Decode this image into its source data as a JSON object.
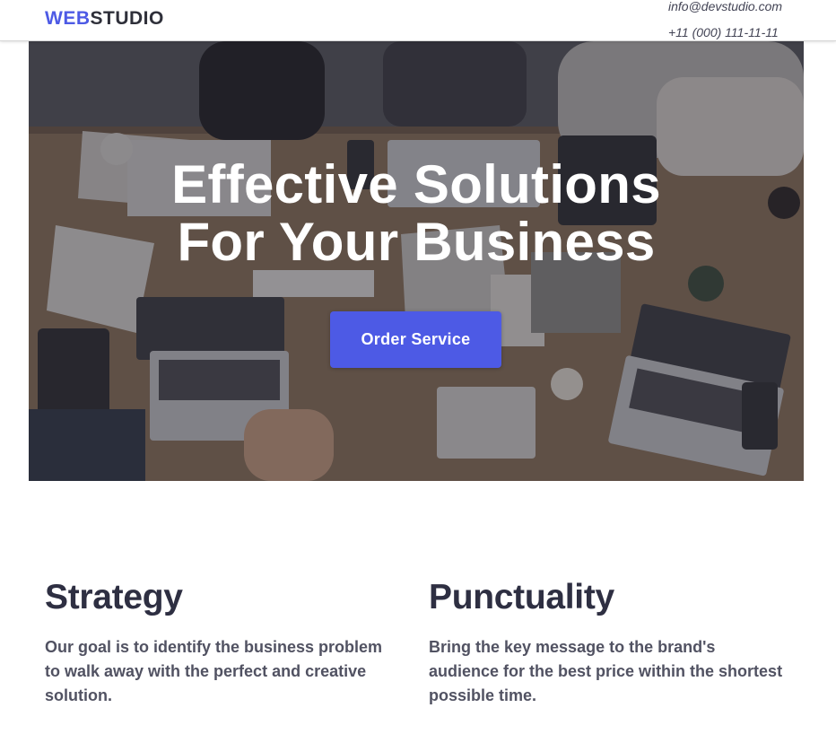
{
  "header": {
    "logo_accent": "WEB",
    "logo_rest": "STUDIO",
    "email": "info@devstudio.com",
    "phone": "+11 (000) 111-11-11"
  },
  "hero": {
    "title": "Effective Solutions\nFor Your Business",
    "button_label": "Order Service",
    "image": "office-desk-meeting-photo"
  },
  "features": [
    {
      "title": "Strategy",
      "text": "Our goal is to identify the business problem to walk away with the perfect and creative solution."
    },
    {
      "title": "Punctuality",
      "text": "Bring the key message to the brand's audience for the best price within the shortest possible time."
    }
  ],
  "colors": {
    "accent": "#4d5ae5",
    "heading": "#2e2f42",
    "text": "#434455",
    "white": "#ffffff"
  }
}
